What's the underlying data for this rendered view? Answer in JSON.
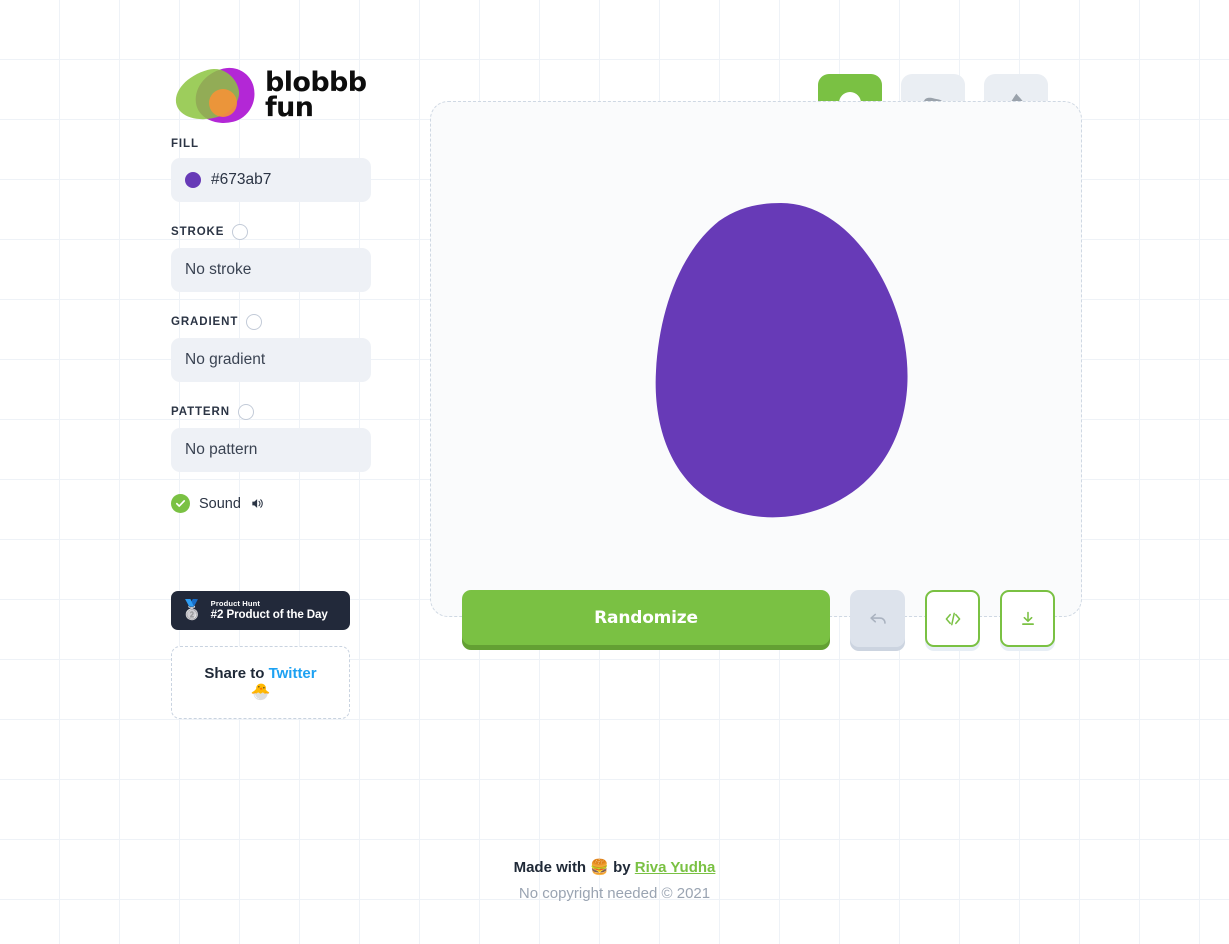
{
  "brand": {
    "line1": "blobbb",
    "line2": "fun",
    "logo_icon": "blobbb-logo-icon",
    "logo_colors": {
      "purple": "#b327d6",
      "green": "#8cc43f",
      "orange": "#f39237"
    }
  },
  "sidebar": {
    "fill": {
      "label": "FILL",
      "value": "#673ab7",
      "swatch_color": "#673ab7"
    },
    "stroke": {
      "label": "STROKE",
      "value": "No stroke",
      "enabled": false
    },
    "gradient": {
      "label": "GRADIENT",
      "value": "No gradient",
      "enabled": false
    },
    "pattern": {
      "label": "PATTERN",
      "value": "No pattern",
      "enabled": false
    },
    "sound": {
      "label": "Sound",
      "checked": true,
      "check_icon": "check-icon",
      "speaker_icon": "speaker-icon"
    },
    "product_hunt": {
      "medal_icon": "silver-medal-icon",
      "kicker": "Product Hunt",
      "title": "#2 Product of the Day"
    },
    "share": {
      "prefix": "Share to ",
      "network": "Twitter",
      "emoji": "🐣",
      "network_color": "#1da1f2"
    }
  },
  "shape_picker": {
    "options": [
      {
        "name": "shape-circle",
        "icon": "circle-blob-icon",
        "active": true
      },
      {
        "name": "shape-blob-a",
        "icon": "soft-blob-icon",
        "active": false
      },
      {
        "name": "shape-blob-b",
        "icon": "pointy-blob-icon",
        "active": false
      }
    ]
  },
  "canvas": {
    "blob_fill": "#673ab7",
    "background": "#fafbfc"
  },
  "actions": {
    "randomize_label": "Randomize",
    "undo": {
      "icon": "undo-arrow-icon",
      "disabled": true
    },
    "code": {
      "icon": "code-brackets-icon"
    },
    "download": {
      "icon": "download-icon"
    }
  },
  "footer": {
    "made_prefix": "Made with ",
    "made_emoji": "🍔",
    "made_middle": " by ",
    "author": "Riva Yudha",
    "copyright": "No copyright needed © 2021"
  }
}
